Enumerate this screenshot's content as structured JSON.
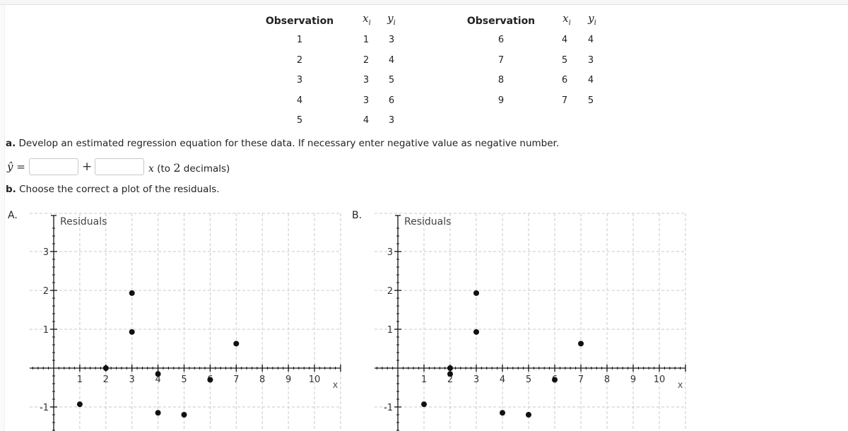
{
  "table": {
    "header_observation": "Observation",
    "header_x": "x",
    "header_x_sub": "i",
    "header_y": "y",
    "header_y_sub": "i",
    "left_rows": [
      {
        "obs": "1",
        "x": "1",
        "y": "3"
      },
      {
        "obs": "2",
        "x": "2",
        "y": "4"
      },
      {
        "obs": "3",
        "x": "3",
        "y": "5"
      },
      {
        "obs": "4",
        "x": "3",
        "y": "6"
      },
      {
        "obs": "5",
        "x": "4",
        "y": "3"
      }
    ],
    "right_rows": [
      {
        "obs": "6",
        "x": "4",
        "y": "4"
      },
      {
        "obs": "7",
        "x": "5",
        "y": "3"
      },
      {
        "obs": "8",
        "x": "6",
        "y": "4"
      },
      {
        "obs": "9",
        "x": "7",
        "y": "5"
      }
    ]
  },
  "question_a": {
    "prefix": "a.",
    "text": " Develop an estimated regression equation for these data. If necessary enter negative value as negative number.",
    "yhat": "ŷ =",
    "plus": "+",
    "x_var": "x",
    "suffix_pre": " (to ",
    "decimals": "2",
    "suffix_post": " decimals)",
    "intercept_value": "",
    "slope_value": ""
  },
  "question_b": {
    "prefix": "b.",
    "text": " Choose the correct a plot of the residuals."
  },
  "chart_data": [
    {
      "type": "scatter",
      "option_label": "A.",
      "ylabel": "Residuals",
      "xlabel": "x",
      "xlim": [
        -0.9,
        11
      ],
      "ylim": [
        -1.5,
        3.9
      ],
      "x_ticks": [
        1,
        2,
        3,
        4,
        5,
        6,
        7,
        8,
        9,
        10
      ],
      "y_ticks": [
        -1,
        1,
        2,
        3
      ],
      "grid": true,
      "points": [
        {
          "x": 1,
          "y": -0.93
        },
        {
          "x": 2,
          "y": 0.0
        },
        {
          "x": 3,
          "y": 1.93
        },
        {
          "x": 3,
          "y": 0.93
        },
        {
          "x": 4,
          "y": -0.15
        },
        {
          "x": 4,
          "y": -1.15
        },
        {
          "x": 5,
          "y": -1.2
        },
        {
          "x": 6,
          "y": -0.3
        },
        {
          "x": 7,
          "y": 0.63
        }
      ]
    },
    {
      "type": "scatter",
      "option_label": "B.",
      "ylabel": "Residuals",
      "xlabel": "x",
      "xlim": [
        -0.9,
        11
      ],
      "ylim": [
        -1.5,
        3.9
      ],
      "x_ticks": [
        1,
        2,
        3,
        4,
        5,
        6,
        7,
        8,
        9,
        10
      ],
      "y_ticks": [
        -1,
        1,
        2,
        3
      ],
      "grid": true,
      "points": [
        {
          "x": 1,
          "y": -0.93
        },
        {
          "x": 2,
          "y": 0.0
        },
        {
          "x": 2,
          "y": -0.15
        },
        {
          "x": 3,
          "y": 1.93
        },
        {
          "x": 3,
          "y": 0.93
        },
        {
          "x": 4,
          "y": -1.15
        },
        {
          "x": 5,
          "y": -1.2
        },
        {
          "x": 6,
          "y": -0.3
        },
        {
          "x": 7,
          "y": 0.63
        }
      ]
    }
  ]
}
